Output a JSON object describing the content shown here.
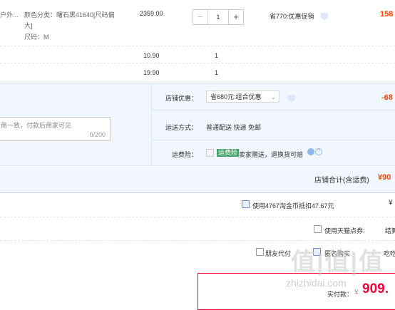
{
  "item1": {
    "title_fragment": "户外...",
    "sku_line1": "颜色分类：曙石黑41640[尺码偏",
    "sku_line2": "大]",
    "size_line": "尺码：M",
    "price": "2359.00",
    "qty": "1",
    "minus": "−",
    "plus": "+",
    "promo": "省770:优惠促销",
    "subtotal": "158"
  },
  "row2": {
    "price": "10.90",
    "qty": "1"
  },
  "row3": {
    "price": "19.90",
    "qty": "1"
  },
  "shop": {
    "discount_label": "店铺优惠：",
    "discount_value": "省680元:组合优惠",
    "discount_amount": "-68",
    "message_placeholder": "商一致，付款后商家可见",
    "message_counter": "0/200",
    "shipping_label": "运送方式：",
    "shipping_value": "普通配送 快递 免邮",
    "insurance_label": "运费险：",
    "insurance_badge": "运费险",
    "insurance_text": "卖家赠送，退换货可赔",
    "total_label": "店铺合计(含运费)",
    "total_value": "¥90"
  },
  "options": {
    "coins": "使用4767淘金币抵扣47.67元",
    "coins_suffix": "¥",
    "tmall_points": "使用天猫点券:",
    "tmall_suffix": "结算",
    "friend_pay": "朋友代付",
    "anon": "匿名购买",
    "anon_suffix": "吃吃"
  },
  "pay": {
    "label": "实付款：",
    "currency": "¥",
    "value": "909."
  },
  "watermark": {
    "logo": "值|值|值",
    "site": "zhizhidai.com"
  },
  "colors": {
    "accent": "#ff0036",
    "panel": "#f2f7ff",
    "link": "#3c7dd9"
  }
}
